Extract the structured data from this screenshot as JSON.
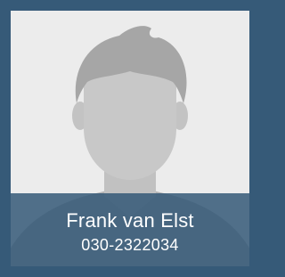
{
  "contact": {
    "name": "Frank van Elst",
    "phone": "030-2322034",
    "avatar_icon": "default-person-silhouette-icon"
  },
  "colors": {
    "frame": "#365a78",
    "card_background": "#ececec",
    "silhouette_hair": "#a6a6a6",
    "silhouette_face": "#c8c8c8",
    "silhouette_body": "#b3b3b3",
    "caption_background": "#365a78",
    "caption_text": "#ffffff"
  }
}
